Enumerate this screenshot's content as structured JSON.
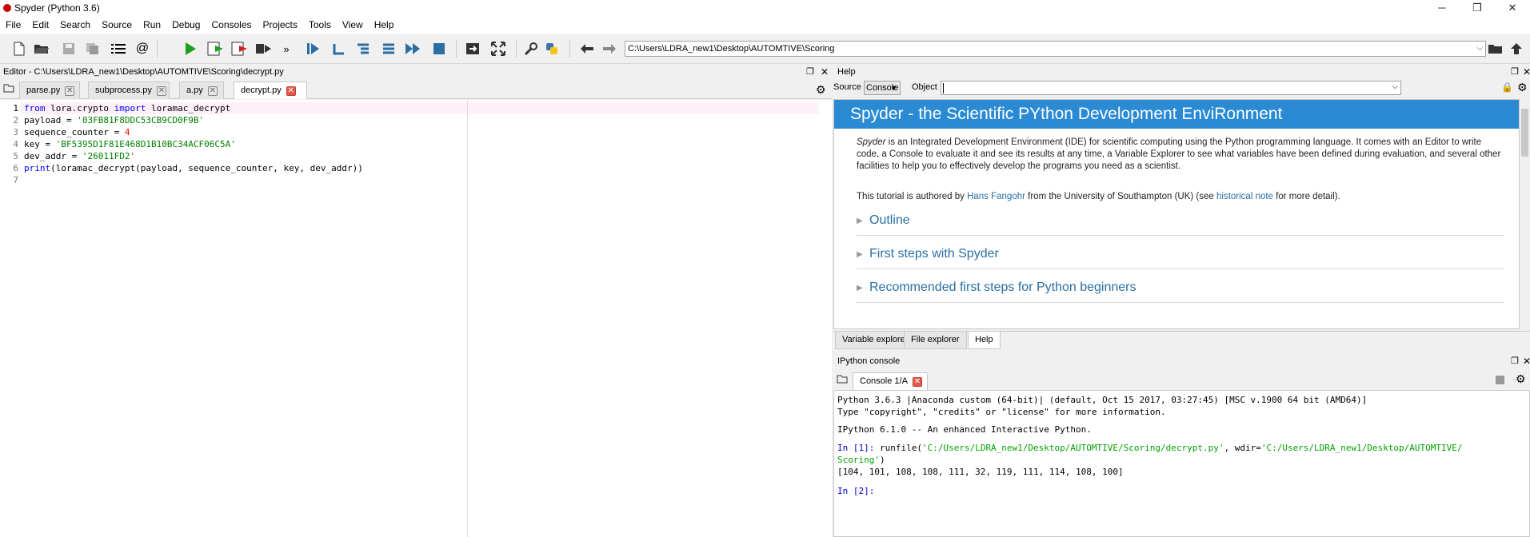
{
  "window": {
    "title": "Spyder (Python 3.6)",
    "minimize": "─",
    "maximize": "❐",
    "close": "✕"
  },
  "menu": [
    "File",
    "Edit",
    "Search",
    "Source",
    "Run",
    "Debug",
    "Consoles",
    "Projects",
    "Tools",
    "View",
    "Help"
  ],
  "toolbar": {
    "path": "C:\\Users\\LDRA_new1\\Desktop\\AUTOMTIVE\\Scoring",
    "more": "»"
  },
  "editor": {
    "header": "Editor - C:\\Users\\LDRA_new1\\Desktop\\AUTOMTIVE\\Scoring\\decrypt.py",
    "tabs": [
      {
        "label": "parse.py"
      },
      {
        "label": "subprocess.py"
      },
      {
        "label": "a.py"
      },
      {
        "label": "decrypt.py"
      }
    ],
    "line_numbers": [
      "1",
      "2",
      "3",
      "4",
      "5",
      "6",
      "7"
    ],
    "code": {
      "l1a": "from",
      "l1b": " lora.crypto ",
      "l1c": "import",
      "l1d": " loramac_decrypt",
      "l2a": "payload = ",
      "l2b": "'03FB81F8DDC53CB9CD0F9B'",
      "l3a": "sequence_counter = ",
      "l3b": "4",
      "l4a": "key = ",
      "l4b": "'BF5395D1F81E468D1B10BC34ACF06C5A'",
      "l5a": "dev_addr = ",
      "l5b": "'26011FD2'",
      "l6a": "print",
      "l6b": "(loramac_decrypt(payload, sequence_counter, key, dev_addr))"
    }
  },
  "help": {
    "header": "Help",
    "source_label": "Source",
    "source_value": "Console",
    "object_label": "Object",
    "banner": "Spyder - the Scientific PYthon Development EnviRonment",
    "intro_em": "Spyder",
    "intro_rest": " is an Integrated Development Environment (IDE) for scientific computing using the Python programming language. It comes with an Editor to write code, a Console to evaluate it and see its results at any time, a Variable Explorer to see what variables have been defined during evaluation, and several other facilities to help you to effectively develop the programs you need as a scientist.",
    "author_pre": "This tutorial is authored by ",
    "author_link": "Hans Fangohr",
    "author_mid": " from the University of Southampton (UK) (see ",
    "note_link": "historical note",
    "author_post": " for more detail).",
    "sections": [
      "Outline",
      "First steps with Spyder",
      "Recommended first steps for Python beginners"
    ],
    "bottom_tabs": [
      "Variable explorer",
      "File explorer",
      "Help"
    ]
  },
  "console": {
    "header": "IPython console",
    "tab": "Console 1/A",
    "l1": "Python 3.6.3 |Anaconda custom (64-bit)| (default, Oct 15 2017, 03:27:45) [MSC v.1900 64 bit (AMD64)]",
    "l2": "Type \"copyright\", \"credits\" or \"license\" for more information.",
    "l3": "IPython 6.1.0 -- An enhanced Interactive Python.",
    "in1_prompt": "In [1]:",
    "in1_cmd": " runfile(",
    "in1_arg1": "'C:/Users/LDRA_new1/Desktop/AUTOMTIVE/Scoring/decrypt.py'",
    "in1_mid": ", wdir=",
    "in1_arg2a": "'C:/Users/LDRA_new1/Desktop/AUTOMTIVE/",
    "in1_arg2b": "Scoring'",
    "in1_close": ")",
    "out1": "[104, 101, 108, 108, 111, 32, 119, 111, 114, 108, 100]",
    "in2_prompt": "In [2]:"
  },
  "colors": {
    "accent": "#2a8ad4",
    "keyword": "#0000ff",
    "string": "#008000",
    "number": "#ff0000",
    "tab_close": "#e05a4a"
  }
}
